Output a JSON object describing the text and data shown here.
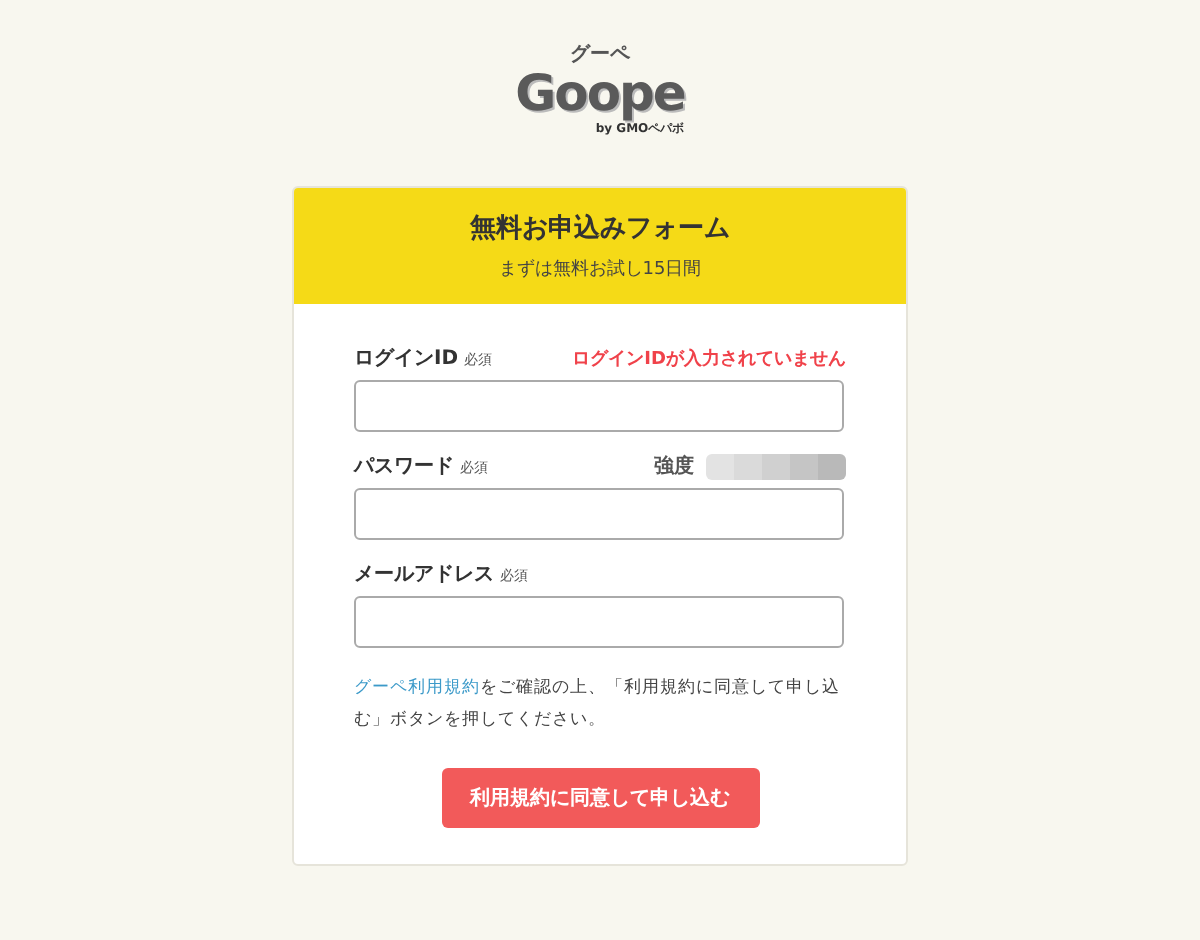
{
  "logo": {
    "kana": "グーペ",
    "wordmark": "Goope",
    "byline": "by GMOペパボ"
  },
  "form": {
    "title": "無料お申込みフォーム",
    "subtitle": "まずは無料お試し15日間",
    "fields": [
      {
        "label": "ログインID",
        "required": "必須",
        "error": "ログインIDが入力されていません"
      },
      {
        "label": "パスワード",
        "required": "必須",
        "strength": {
          "label": "強度"
        }
      },
      {
        "label": "メールアドレス",
        "required": "必須"
      }
    ],
    "terms": {
      "link": "グーペ利用規約",
      "text": "をご確認の上、「利用規約に同意して申し込む」ボタンを押してください。"
    },
    "submit": "利用規約に同意して申し込む"
  }
}
